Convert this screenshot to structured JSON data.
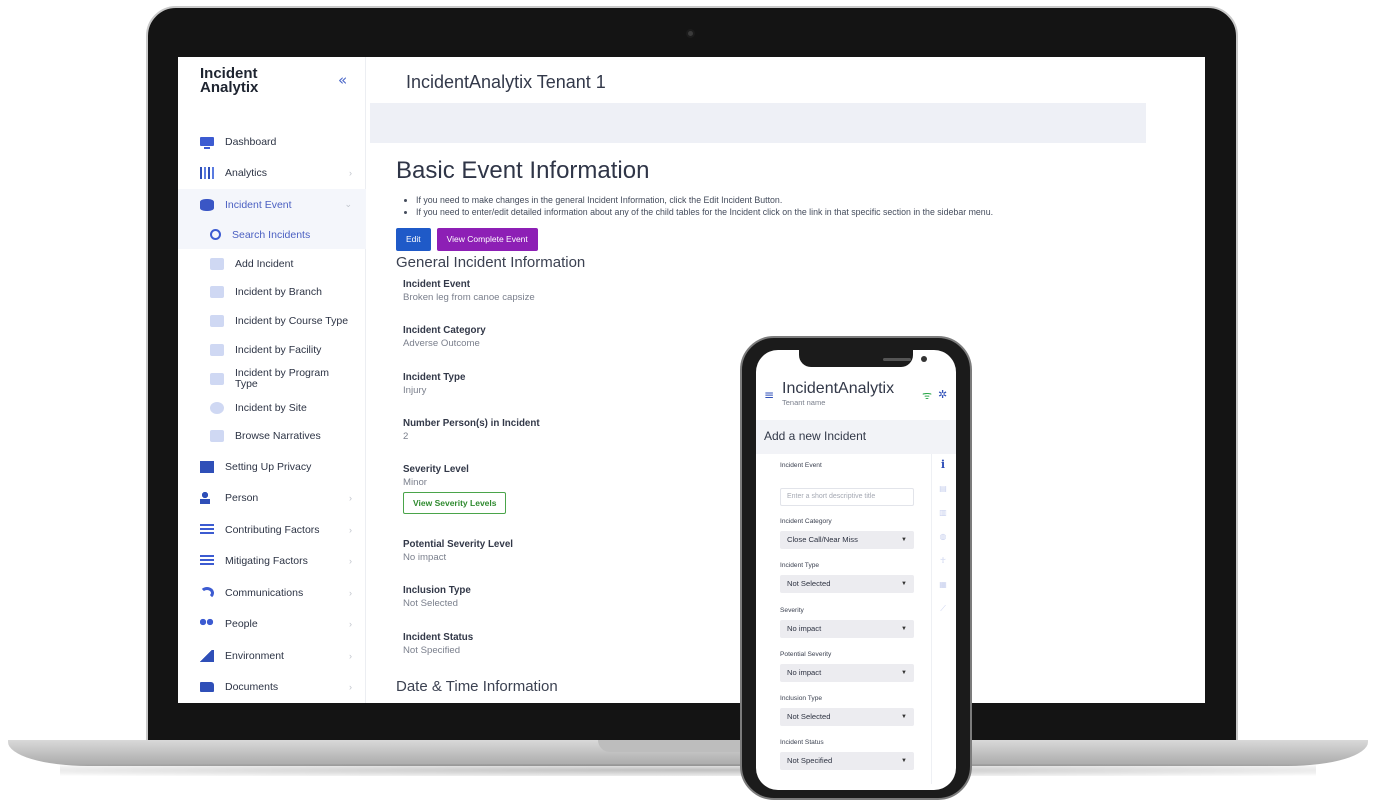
{
  "brand": {
    "line1": "Incident",
    "line2": "Analytix",
    "collapse_icon": "double-chevron-left-icon"
  },
  "header": {
    "tenant": "IncidentAnalytix Tenant 1"
  },
  "sidebar": {
    "items": [
      {
        "label": "Dashboard",
        "icon": "monitor-icon"
      },
      {
        "label": "Analytics",
        "icon": "bar-chart-icon"
      },
      {
        "label": "Incident Event",
        "icon": "database-icon"
      },
      {
        "label": "Search Incidents",
        "icon": "magnifier-icon"
      },
      {
        "label": "Add Incident",
        "icon": "plus-icon"
      },
      {
        "label": "Incident by Branch",
        "icon": "store-icon"
      },
      {
        "label": "Incident by Course Type",
        "icon": "chart-icon"
      },
      {
        "label": "Incident by Facility",
        "icon": "building-icon"
      },
      {
        "label": "Incident by Program Type",
        "icon": "blocks-icon"
      },
      {
        "label": "Incident by Site",
        "icon": "globe-icon"
      },
      {
        "label": "Browse Narratives",
        "icon": "play-icon"
      },
      {
        "label": "Setting Up Privacy",
        "icon": "document-icon"
      },
      {
        "label": "Person",
        "icon": "person-icon"
      },
      {
        "label": "Contributing Factors",
        "icon": "checklist-icon"
      },
      {
        "label": "Mitigating Factors",
        "icon": "checklist-icon"
      },
      {
        "label": "Communications",
        "icon": "signal-icon"
      },
      {
        "label": "People",
        "icon": "people-icon"
      },
      {
        "label": "Environment",
        "icon": "tree-icon"
      },
      {
        "label": "Documents",
        "icon": "folder-icon"
      }
    ]
  },
  "main": {
    "title": "Basic Event Information",
    "bullets": [
      "If you need to make changes in the general Incident Information, click the Edit Incident Button.",
      "If you need to enter/edit detailed information about any of the child tables for the Incident click on the link in that specific section in the sidebar menu."
    ],
    "edit_label": "Edit",
    "view_label": "View Complete Event",
    "section1": "General Incident Information",
    "fields": [
      {
        "label": "Incident Event",
        "value": "Broken leg from canoe capsize"
      },
      {
        "label": "Incident Category",
        "value": "Adverse Outcome"
      },
      {
        "label": "Incident Type",
        "value": "Injury"
      },
      {
        "label": "Number Person(s) in Incident",
        "value": "2"
      },
      {
        "label": "Severity Level",
        "value": "Minor"
      },
      {
        "label": "Potential Severity Level",
        "value": "No impact"
      },
      {
        "label": "Inclusion Type",
        "value": "Not Selected"
      },
      {
        "label": "Incident Status",
        "value": "Not Specified"
      }
    ],
    "severity_button": "View Severity Levels",
    "section2": "Date & Time Information"
  },
  "phone": {
    "title": "IncidentAnalytix",
    "subtitle": "Tenant name",
    "heading": "Add a new Incident",
    "event_label": "Incident Event",
    "event_placeholder": "Enter a short descriptive title",
    "fields": [
      {
        "label": "Incident Category",
        "value": "Close Call/Near Miss"
      },
      {
        "label": "Incident Type",
        "value": "Not Selected"
      },
      {
        "label": "Severity",
        "value": "No impact"
      },
      {
        "label": "Potential Severity",
        "value": "No impact"
      },
      {
        "label": "Inclusion Type",
        "value": "Not Selected"
      },
      {
        "label": "Incident Status",
        "value": "Not Specified"
      }
    ],
    "side_icons": [
      "info-icon",
      "document-icon",
      "chart-icon",
      "globe-icon",
      "person-icon",
      "list-icon",
      "link-icon"
    ]
  }
}
